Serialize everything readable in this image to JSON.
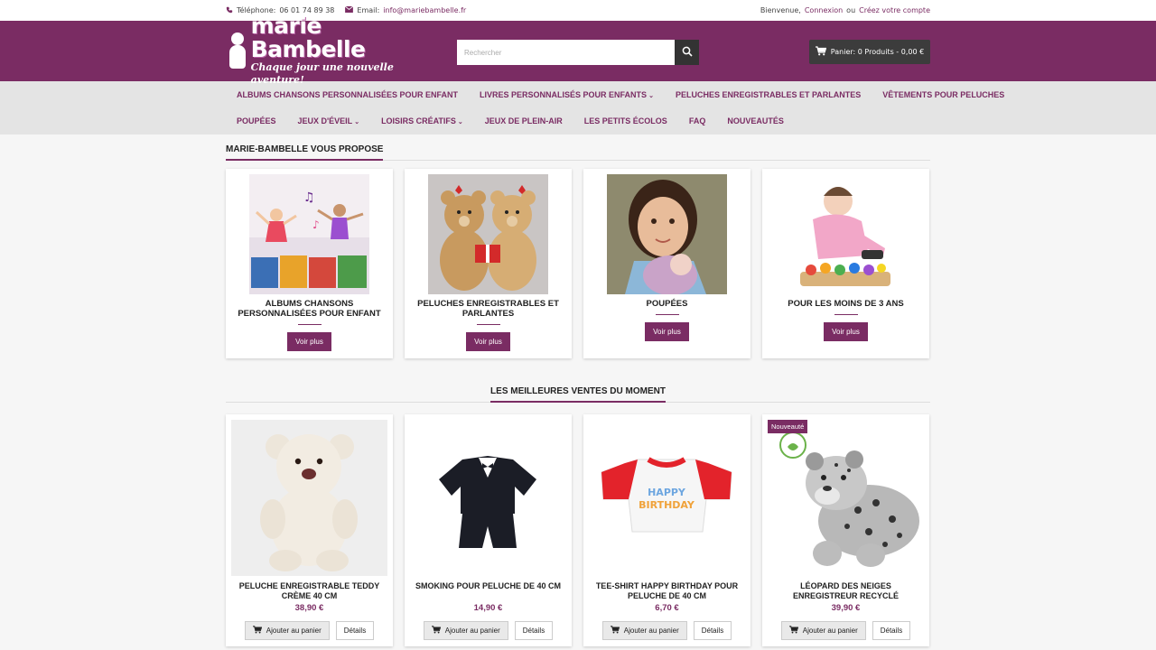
{
  "topbar": {
    "phone_label": "Téléphone:",
    "phone": "06 01 74 89 38",
    "email_label": "Email:",
    "email": "info@mariebambelle.fr",
    "welcome": "Bienvenue,",
    "login": "Connexion",
    "or": "ou",
    "register": "Créez votre compte"
  },
  "header": {
    "brand": "marie Bambelle",
    "slogan": "Chaque jour une nouvelle aventure!",
    "search_placeholder": "Rechercher",
    "cart": "Panier: 0 Produits - 0,00 €"
  },
  "colors": {
    "brand": "#7a2c63",
    "nav_bg": "#e4e4e4"
  },
  "nav": {
    "row1": [
      {
        "label": "Albums chansons personnalisées pour enfant",
        "dropdown": false
      },
      {
        "label": "Livres personnalisés pour enfants",
        "dropdown": true
      },
      {
        "label": "Peluches enregistrables et parlantes",
        "dropdown": false
      },
      {
        "label": "Vêtements pour peluches",
        "dropdown": false
      }
    ],
    "row2": [
      {
        "label": "Poupées",
        "dropdown": false
      },
      {
        "label": "Jeux d'éveil",
        "dropdown": true
      },
      {
        "label": "Loisirs créatifs",
        "dropdown": true
      },
      {
        "label": "Jeux de plein-air",
        "dropdown": false
      },
      {
        "label": "Les petits écolos",
        "dropdown": false
      },
      {
        "label": "FAQ",
        "dropdown": false
      },
      {
        "label": "Nouveautés",
        "dropdown": false
      }
    ]
  },
  "categories": {
    "title": "Marie-Bambelle vous propose",
    "button": "Voir plus",
    "items": [
      {
        "name": "Albums chansons personnalisées pour enfant",
        "image": "children-dancing-albums"
      },
      {
        "name": "Peluches enregistrables et parlantes",
        "image": "teddy-bears-couple"
      },
      {
        "name": "Poupées",
        "image": "girl-with-doll"
      },
      {
        "name": "Pour les moins de 3 ans",
        "image": "toddler-playing"
      }
    ]
  },
  "bestsellers": {
    "title": "Les meilleures ventes du moment",
    "add_label": "Ajouter au panier",
    "details_label": "Détails",
    "products": [
      {
        "name": "Peluche enregistrable Teddy crème 40 cm",
        "price": "38,90 €",
        "image": "cream-teddy-bear",
        "badge": ""
      },
      {
        "name": "Smoking pour peluche de 40 cm",
        "price": "14,90 €",
        "image": "tuxedo-outfit",
        "badge": ""
      },
      {
        "name": "Tee-shirt Happy Birthday pour peluche de 40 cm",
        "price": "6,70 €",
        "image": "birthday-tshirt",
        "badge": ""
      },
      {
        "name": "Léopard des neiges enregistreur recyclé",
        "price": "39,90 €",
        "image": "snow-leopard-plush",
        "badge": "Nouveauté"
      }
    ]
  }
}
